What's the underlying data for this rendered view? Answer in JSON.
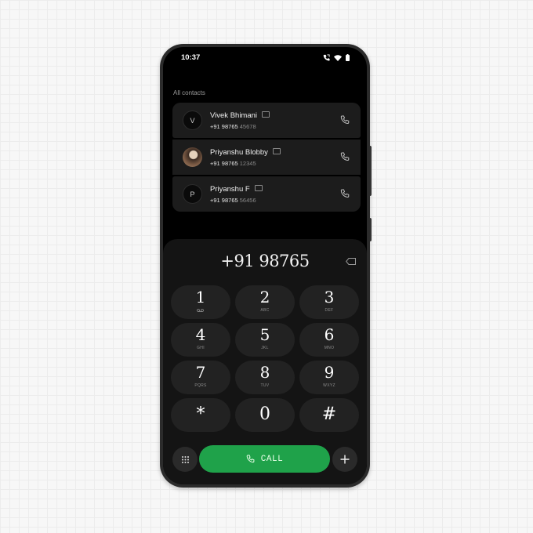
{
  "status_bar": {
    "time": "10:37"
  },
  "contacts_section": {
    "label": "All contacts",
    "items": [
      {
        "name": "Vivek Bhimani",
        "avatar_initial": "V",
        "number_prefix": "+91 98765",
        "number_suffix": "45678"
      },
      {
        "name": "Priyanshu Blobby",
        "avatar_initial": "",
        "number_prefix": "+91 98765",
        "number_suffix": "12345"
      },
      {
        "name": "Priyanshu F",
        "avatar_initial": "P",
        "number_prefix": "+91 98765",
        "number_suffix": "56456"
      }
    ]
  },
  "dialer": {
    "display_number": "+91 98765",
    "keys": [
      {
        "digit": "1",
        "letters": "",
        "icon": "voicemail-icon"
      },
      {
        "digit": "2",
        "letters": "ABC"
      },
      {
        "digit": "3",
        "letters": "DEF"
      },
      {
        "digit": "4",
        "letters": "GHI"
      },
      {
        "digit": "5",
        "letters": "JKL"
      },
      {
        "digit": "6",
        "letters": "MNO"
      },
      {
        "digit": "7",
        "letters": "PQRS"
      },
      {
        "digit": "8",
        "letters": "TUV"
      },
      {
        "digit": "9",
        "letters": "WXYZ"
      },
      {
        "digit": "*",
        "letters": ""
      },
      {
        "digit": "0",
        "letters": ""
      },
      {
        "digit": "#",
        "letters": ""
      }
    ],
    "call_label": "CALL"
  },
  "colors": {
    "call_green": "#1fa24a",
    "screen_bg": "#000000",
    "key_bg": "#222222"
  }
}
